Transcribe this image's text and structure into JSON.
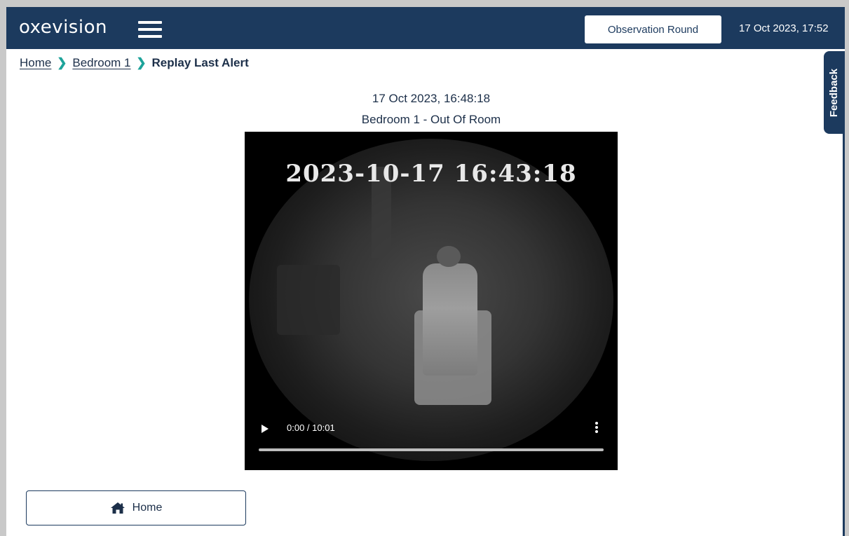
{
  "header": {
    "logo_text": "oxevision",
    "menu_icon": "hamburger-menu-icon",
    "observation_round_label": "Observation Round",
    "datetime": "17 Oct 2023, 17:52"
  },
  "breadcrumb": {
    "items": [
      {
        "label": "Home"
      },
      {
        "label": "Bedroom 1"
      },
      {
        "label": "Replay Last Alert"
      }
    ],
    "separator_icon": "chevron-right-icon"
  },
  "feedback": {
    "label": "Feedback"
  },
  "alert": {
    "datetime": "17 Oct 2023, 16:48:18",
    "title": "Bedroom 1 - Out Of Room"
  },
  "video": {
    "overlay_timestamp": "2023-10-17  16:43:18",
    "time_display": "0:00 / 10:01",
    "progress": 0
  },
  "footer": {
    "home_button_label": "Home",
    "home_button_icon": "home-icon"
  },
  "colors": {
    "primary": "#1c3a5e",
    "accent": "#1ea39a",
    "text": "#1c2f49"
  }
}
